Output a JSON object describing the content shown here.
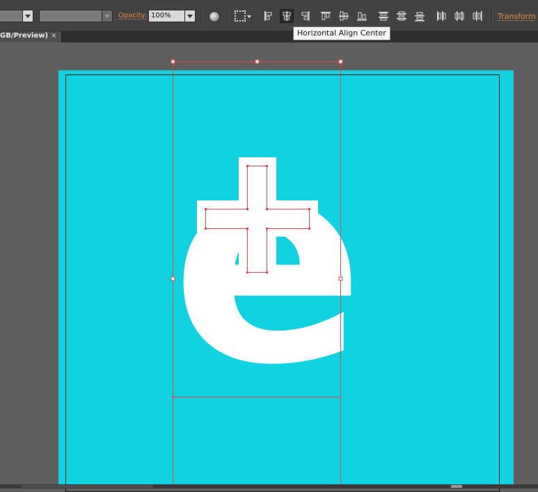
{
  "control_bar": {
    "opacity_label": "Opacity:",
    "opacity_value": "100%",
    "transform_label": "Transform",
    "accent_color": "#e9893a",
    "align_icons": [
      "horizontal-align-left-icon",
      "horizontal-align-center-icon",
      "horizontal-align-right-icon",
      "vertical-align-top-icon",
      "vertical-align-center-icon",
      "vertical-align-bottom-icon",
      "vertical-distribute-top-icon",
      "vertical-distribute-center-icon",
      "vertical-distribute-bottom-icon",
      "horizontal-distribute-left-icon",
      "horizontal-distribute-center-icon",
      "horizontal-distribute-right-icon"
    ],
    "active_align": "horizontal-align-center-icon"
  },
  "tooltip": {
    "text": "Horizontal Align Center"
  },
  "document_tab": {
    "title": "GB/Preview)",
    "close_glyph": "×"
  },
  "canvas": {
    "artboard_color": "#10d2e1",
    "selection_color": "#e2474b",
    "glyph": "e"
  }
}
